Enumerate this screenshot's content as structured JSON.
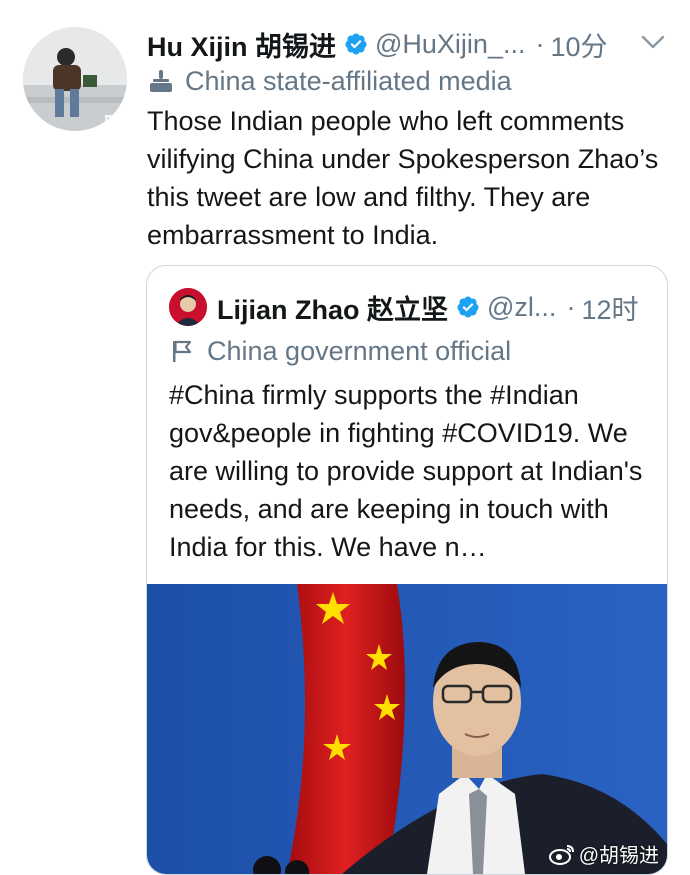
{
  "tweet": {
    "author_name": "Hu Xijin 胡锡进",
    "handle": "@HuXijin_...",
    "separator": "·",
    "time": "10分",
    "label": "China state-affiliated media",
    "text": "Those Indian people who left comments vilifying China under Spokesperson Zhao’s this tweet are low and filthy. They are embarrassment to India.",
    "avatar_caption": "Sarajev",
    "verified": true
  },
  "quoted_tweet": {
    "author_name": "Lijian Zhao 赵立坚",
    "handle": "@zl...",
    "separator": "·",
    "time": "12时",
    "label": "China government official",
    "text": "#China firmly supports the #Indian gov&people in fighting #COVID19. We are willing to provide support at Indian's needs, and are keeping in touch with India for this. We have n…",
    "verified": true
  },
  "watermark": {
    "text": "@胡锡进"
  },
  "colors": {
    "verified": "#1da1f2",
    "secondary_text": "#657786",
    "border": "#ccd6dd"
  },
  "icons": [
    "verified-badge-icon",
    "chevron-down-icon",
    "podium-icon",
    "flag-icon",
    "weibo-icon"
  ]
}
